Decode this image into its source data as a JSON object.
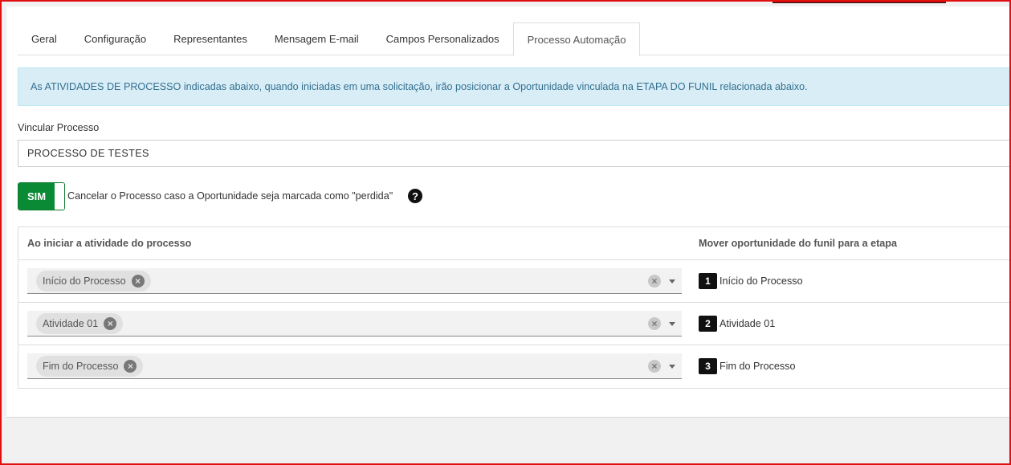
{
  "tabs": [
    {
      "label": "Geral"
    },
    {
      "label": "Configuração"
    },
    {
      "label": "Representantes"
    },
    {
      "label": "Mensagem E-mail"
    },
    {
      "label": "Campos Personalizados"
    },
    {
      "label": "Processo Automação",
      "active": true
    }
  ],
  "alert": {
    "text": "As ATIVIDADES DE PROCESSO indicadas abaixo, quando iniciadas em uma solicitação, irão posicionar a Oportunidade vinculada na ETAPA DO FUNIL relacionada abaixo."
  },
  "vincular": {
    "label": "Vincular Processo",
    "value": "PROCESSO DE TESTES"
  },
  "cancel_toggle": {
    "state_label": "SIM",
    "description": "Cancelar o Processo caso a Oportunidade seja marcada como \"perdida\"",
    "help_icon": "question-circle-icon"
  },
  "table": {
    "header_left": "Ao iniciar a atividade do processo",
    "header_right": "Mover oportunidade do funil para a etapa",
    "rows": [
      {
        "activity": "Início do Processo",
        "stage_number": "1",
        "stage_name": "Início do Processo"
      },
      {
        "activity": "Atividade 01",
        "stage_number": "2",
        "stage_name": "Atividade 01"
      },
      {
        "activity": "Fim do Processo",
        "stage_number": "3",
        "stage_name": "Fim do Processo"
      }
    ]
  },
  "colors": {
    "alert_bg": "#d9edf7",
    "alert_text": "#31708f",
    "toggle_green": "#0a8a34",
    "frame_red": "#e01010"
  }
}
